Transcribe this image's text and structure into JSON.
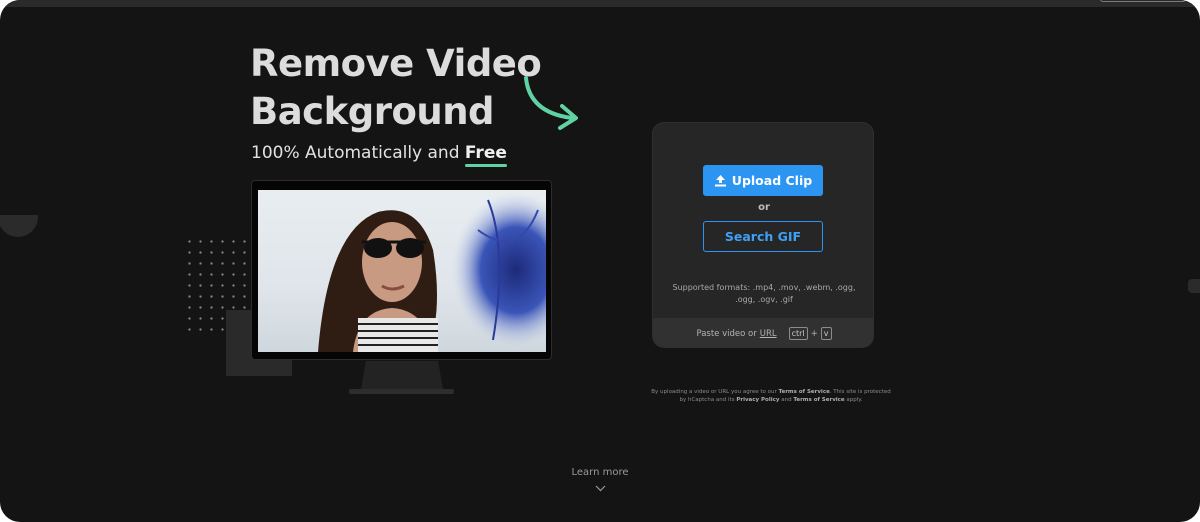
{
  "hero": {
    "title_line1": "Remove Video",
    "title_line2": "Background",
    "subtitle_prefix": "100% Automatically and ",
    "subtitle_highlight": "Free"
  },
  "upload_card": {
    "upload_label": "Upload Clip",
    "or_label": "or",
    "search_label": "Search GIF",
    "formats_text": "Supported formats: .mp4, .mov, .webm, .ogg, .ogg, .ogv, .gif",
    "paste_prefix": "Paste video or",
    "paste_url": "URL",
    "key_ctrl": "ctrl",
    "key_plus": "+",
    "key_v": "v"
  },
  "legal": {
    "part1": "By uploading a video or URL you agree to our ",
    "terms": "Terms of Service",
    "part2": ". This site is protected by hCaptcha and its ",
    "privacy": "Privacy Policy",
    "part3": " and ",
    "terms2": "Terms of Service",
    "part4": " apply."
  },
  "footer": {
    "learn_more": "Learn more"
  },
  "colors": {
    "background": "#141414",
    "accent_blue": "#2c95f2",
    "accent_green": "#5fd3a3",
    "card": "#262626"
  },
  "icons": [
    "upload-icon",
    "curved-arrow-icon",
    "chevron-down-icon"
  ]
}
